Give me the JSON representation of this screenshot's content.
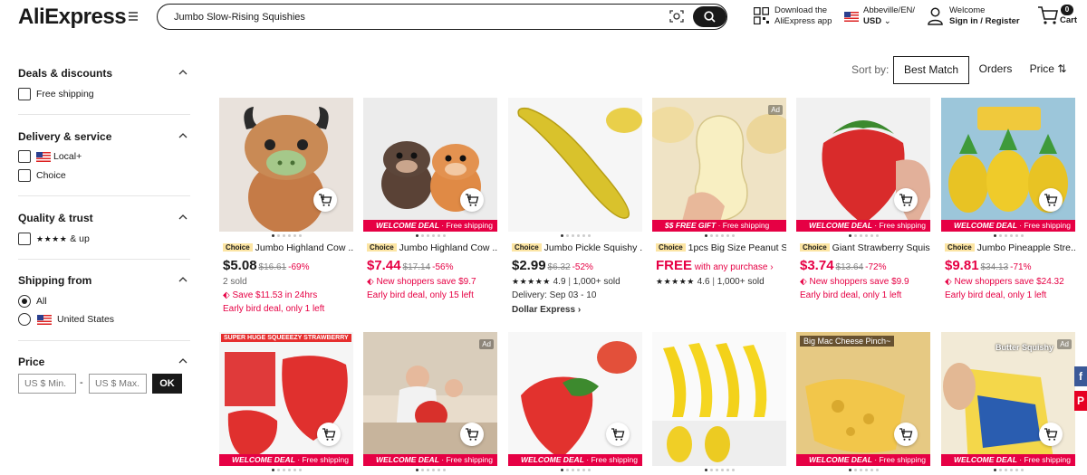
{
  "header": {
    "logo": "AliExpress",
    "search": {
      "value": "Jumbo Slow-Rising Squishies"
    },
    "download": {
      "line1": "Download the",
      "line2": "AliExpress app"
    },
    "locale": {
      "line1": "Abbeville/EN/",
      "line2": "USD"
    },
    "account": {
      "line1": "Welcome",
      "line2": "Sign in / Register"
    },
    "cart": {
      "count": "0",
      "label": "Cart"
    }
  },
  "filters": {
    "deals": {
      "title": "Deals & discounts",
      "options": [
        "Free shipping"
      ]
    },
    "delivery": {
      "title": "Delivery & service",
      "options": [
        "Local+",
        "Choice"
      ]
    },
    "quality": {
      "title": "Quality & trust",
      "stars": "★★★★",
      "suffix": "& up"
    },
    "shipping_from": {
      "title": "Shipping from",
      "options": [
        "All",
        "United States"
      ],
      "selected": "All"
    },
    "price": {
      "title": "Price",
      "min_placeholder": "US $ Min.",
      "max_placeholder": "US $ Max.",
      "separator": "-",
      "ok": "OK"
    }
  },
  "sort": {
    "label": "Sort by:",
    "options": [
      "Best Match",
      "Orders",
      "Price"
    ],
    "active": "Best Match"
  },
  "products": [
    {
      "choice": "Choice",
      "title": "Jumbo Highland Cow ...",
      "price": "$5.08",
      "was": "$16.61",
      "off": "-69%",
      "l1": "2 sold",
      "l2": "Save $11.53 in 24hrs",
      "l3": "Early bird deal, only 1 left"
    },
    {
      "banner": "WELCOME DEAL",
      "banner_sub": "Free shipping",
      "choice": "Choice",
      "title": "Jumbo Highland Cow ...",
      "price": "$7.44",
      "was": "$17.14",
      "off": "-56%",
      "l1": "New shoppers save $9.7",
      "l2": "Early bird deal, only 15 left"
    },
    {
      "choice": "Choice",
      "title": "Jumbo Pickle Squishy ...",
      "price": "$2.99",
      "was": "$6.32",
      "off": "-52%",
      "rating_stars": "★★★★★",
      "rating": "4.9",
      "sold": "1,000+ sold",
      "l2": "Delivery: Sep 03 - 10",
      "l3": "Dollar Express"
    },
    {
      "ad": "Ad",
      "banner": "$$ FREE GIFT",
      "banner_sub": "Free shipping",
      "choice": "Choice",
      "title": "1pcs Big Size Peanut S...",
      "price": "FREE",
      "price_note": "with any purchase",
      "rating_stars": "★★★★★",
      "rating": "4.6",
      "sold": "1,000+ sold"
    },
    {
      "banner": "WELCOME DEAL",
      "banner_sub": "Free shipping",
      "choice": "Choice",
      "title": "Giant Strawberry Squis...",
      "price": "$3.74",
      "was": "$13.64",
      "off": "-72%",
      "l1": "New shoppers save $9.9",
      "l2": "Early bird deal, only 1 left"
    },
    {
      "banner": "WELCOME DEAL",
      "banner_sub": "Free shipping",
      "choice": "Choice",
      "title": "Jumbo Pineapple Stre...",
      "price": "$9.81",
      "was": "$34.13",
      "off": "-71%",
      "l1": "New shoppers save $24.32",
      "l2": "Early bird deal, only 1 left"
    }
  ],
  "products_row2": [
    {
      "banner": "WELCOME DEAL",
      "banner_sub": "Free shipping",
      "img_text": "SUPER HUGE SQUEEEZY STRAWBERRY"
    },
    {
      "ad": "Ad",
      "banner": "WELCOME DEAL",
      "banner_sub": "Free shipping"
    },
    {
      "banner": "WELCOME DEAL",
      "banner_sub": "Free shipping"
    },
    {
      "banner": "",
      "banner_sub": ""
    },
    {
      "banner": "WELCOME DEAL",
      "banner_sub": "Free shipping",
      "img_text": "Big Mac Cheese Pinch~"
    },
    {
      "ad": "Ad",
      "banner": "WELCOME DEAL",
      "banner_sub": "Free shipping",
      "img_text": "Butter Squishy"
    }
  ],
  "share": [
    "f",
    "P"
  ],
  "colors": {
    "accent": "#e60044",
    "brand": "#e62e04",
    "choice": "#fce5a3"
  }
}
